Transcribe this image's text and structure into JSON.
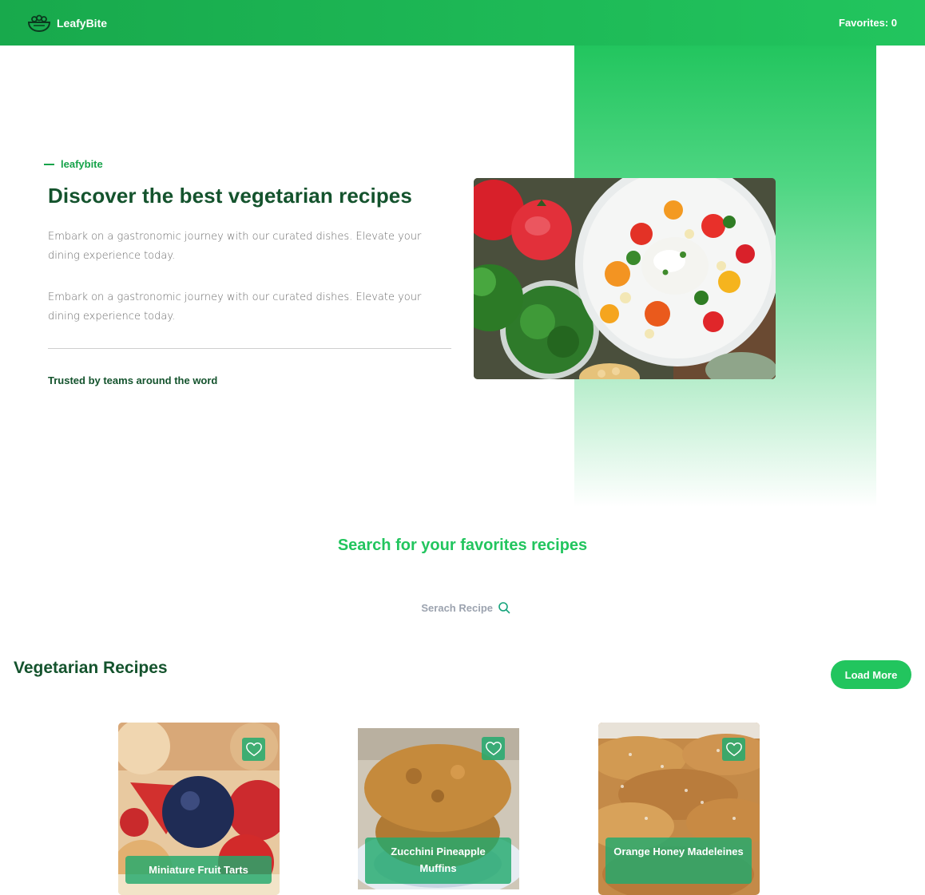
{
  "header": {
    "brand": "LeafyBite",
    "brand_icon": "salad-bowl-icon",
    "favorites_label": "Favorites: 0"
  },
  "hero": {
    "eyebrow": "leafybite",
    "title": "Discover the best vegetarian recipes",
    "paragraph_1": "Embark on a gastronomic journey with our curated dishes. Elevate your dining experience today.",
    "paragraph_2": "Embark on a gastronomic journey with our curated dishes. Elevate your dining experience today.",
    "trusted": "Trusted by teams around the word"
  },
  "search": {
    "title": "Search for your favorites recipes",
    "placeholder": "Serach Recipe",
    "icon": "search-icon"
  },
  "recipes": {
    "title": "Vegetarian Recipes",
    "load_more_label": "Load More",
    "items": [
      {
        "name": "Miniature Fruit Tarts"
      },
      {
        "name": "Zucchini Pineapple Muffins"
      },
      {
        "name": "Orange Honey Madeleines"
      }
    ]
  },
  "colors": {
    "brand_green": "#22c55e",
    "dark_green": "#14532d",
    "label_green": "#22aa6e"
  }
}
